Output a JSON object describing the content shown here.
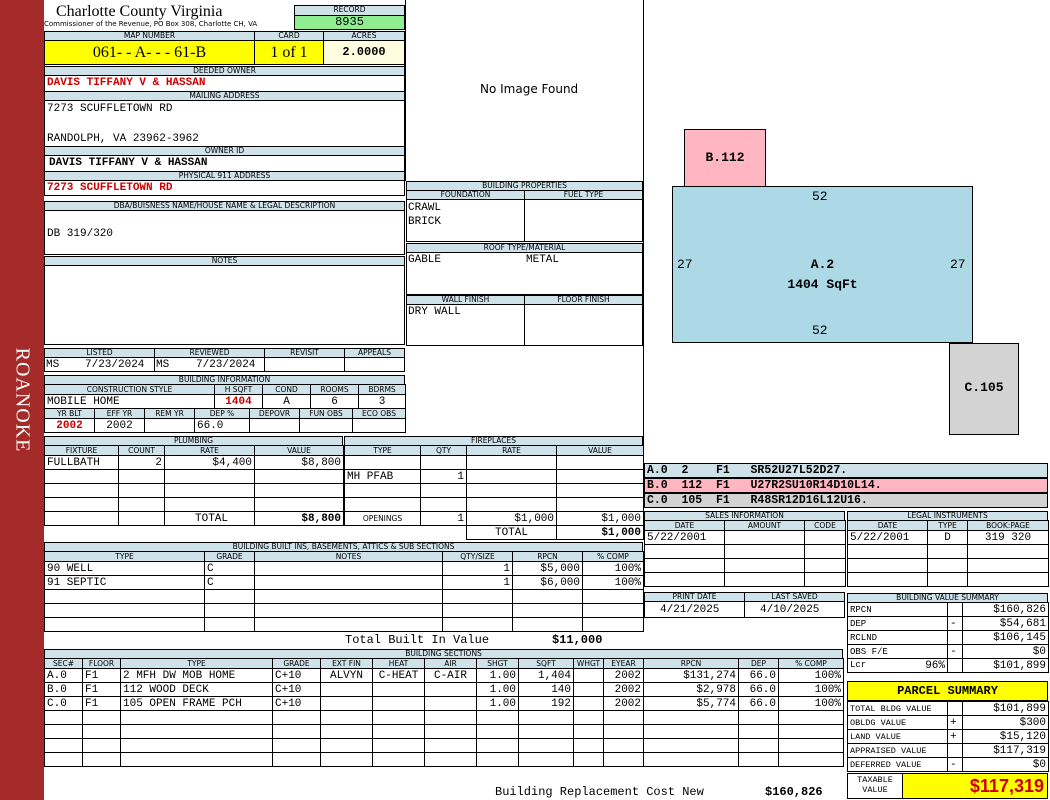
{
  "sidebar": {
    "label": "ROANOKE",
    "color": "#a52a2a"
  },
  "county": {
    "title": "Charlotte County Virginia",
    "subtitle": "Commissioner of the Revenue, PO Box 308, Charlotte CH, VA"
  },
  "record": {
    "label": "RECORD",
    "value": "8935"
  },
  "map": {
    "label": "MAP NUMBER",
    "value": "061- - A- - - 61-B"
  },
  "card": {
    "label": "CARD",
    "value": "1 of 1"
  },
  "acres": {
    "label": "ACRES",
    "value": "2.0000"
  },
  "deeded_owner": {
    "label": "DEEDED OWNER",
    "value": "DAVIS TIFFANY V & HASSAN"
  },
  "mailing": {
    "label": "MAILING ADDRESS",
    "line1": "7273 SCUFFLETOWN RD",
    "line2": "RANDOLPH, VA 23962-3962"
  },
  "owner_id": {
    "label": "OWNER ID",
    "value": "DAVIS TIFFANY V & HASSAN"
  },
  "physical": {
    "label": "PHYSICAL 911 ADDRESS",
    "value": "7273 SCUFFLETOWN RD"
  },
  "dba": {
    "label": "DBA/BUISNESS NAME/HOUSE NAME & LEGAL DESCRIPTION",
    "value": "DB 319/320"
  },
  "notes": {
    "label": "NOTES"
  },
  "listing": {
    "listed_label": "LISTED",
    "reviewed_label": "REVIEWED",
    "revisit_label": "REVISIT",
    "appeals_label": "APPEALS",
    "listed_by": "MS",
    "listed_date": "7/23/2024",
    "reviewed_by": "MS",
    "reviewed_date": "7/23/2024"
  },
  "building_info": {
    "label": "BUILDING INFORMATION",
    "construction_label": "CONSTRUCTION STYLE",
    "hsqft_label": "H SQFT",
    "cond_label": "COND",
    "rooms_label": "ROOMS",
    "bdrms_label": "BDRMS",
    "construction": "MOBILE HOME",
    "hsqft": "1404",
    "cond": "A",
    "rooms": "6",
    "bdrms": "3",
    "yrblt_label": "YR BLT",
    "effyr_label": "EFF YR",
    "remyr_label": "REM YR",
    "dep_label": "DEP %",
    "depovr_label": "DEPOVR",
    "funobs_label": "FUN OBS",
    "ecoobs_label": "ECO OBS",
    "yrblt": "2002",
    "effyr": "2002",
    "dep": "66.0"
  },
  "no_image": "No Image Found",
  "building_props": {
    "label": "BUILDING PROPERTIES",
    "foundation_label": "FOUNDATION",
    "fuel_label": "FUEL TYPE",
    "foundation1": "CRAWL",
    "foundation2": "BRICK",
    "roof_label": "ROOF TYPE/MATERIAL",
    "roof_type": "GABLE",
    "roof_material": "METAL",
    "wall_label": "WALL FINISH",
    "floor_label": "FLOOR FINISH",
    "wall": "DRY WALL"
  },
  "sketch": {
    "b_label": "B.112",
    "a_label": "A.2",
    "a_sqft": "1404 SqFt",
    "c_label": "C.105",
    "top": "52",
    "bottom": "52",
    "left": "27",
    "right": "27",
    "colors": {
      "a": "#add8e6",
      "b": "#ffb6c1",
      "c": "#d3d3d3"
    }
  },
  "sketch_codes": [
    {
      "text": "A.0  2    F1   SR52U27L52D27.",
      "color": "#cfe2ea"
    },
    {
      "text": "B.0  112  F1   U27R2SU10R14D10L14.",
      "color": "#ffb6c1"
    },
    {
      "text": "C.0  105  F1   R48SR12D16L12U16.",
      "color": "#d3d3d3"
    }
  ],
  "plumbing": {
    "label": "PLUMBING",
    "headers": [
      "FIXTURE",
      "COUNT",
      "RATE",
      "VALUE"
    ],
    "rows": [
      [
        "FULLBATH",
        "2",
        "$4,400",
        "$8,800"
      ]
    ],
    "total_label": "TOTAL",
    "total": "$8,800"
  },
  "fireplaces": {
    "label": "FIREPLACES",
    "headers": [
      "TYPE",
      "QTY",
      "RATE",
      "VALUE"
    ],
    "rows": [
      [
        "MH PFAB",
        "1",
        "",
        ""
      ]
    ],
    "openings_label": "OPENINGS",
    "openings_qty": "1",
    "openings_rate": "$1,000",
    "openings_value": "$1,000",
    "total_label": "TOTAL",
    "total": "$1,000"
  },
  "sales": {
    "label": "SALES INFORMATION",
    "headers": [
      "DATE",
      "AMOUNT",
      "CODE"
    ],
    "rows": [
      [
        "5/22/2001",
        "",
        ""
      ]
    ]
  },
  "legal": {
    "label": "LEGAL INSTRUMENTS",
    "headers": [
      "DATE",
      "TYPE",
      "BOOK:PAGE"
    ],
    "rows": [
      [
        "5/22/2001",
        "D",
        "319 320"
      ]
    ]
  },
  "dates": {
    "print_label": "PRINT DATE",
    "saved_label": "LAST SAVED",
    "print": "4/21/2025",
    "saved": "4/10/2025"
  },
  "builtins": {
    "label": "BUILDING BUILT INS, BASEMENTS, ATTICS & SUB SECTIONS",
    "headers": [
      "TYPE",
      "GRADE",
      "NOTES",
      "QTY/SIZE",
      "RPCN",
      "% COMP"
    ],
    "rows": [
      [
        "90 WELL",
        "C",
        "",
        "1",
        "$5,000",
        "100%"
      ],
      [
        "91 SEPTIC",
        "C",
        "",
        "1",
        "$6,000",
        "100%"
      ]
    ],
    "total_label": "Total Built In Value",
    "total": "$11,000"
  },
  "value_summary": {
    "label": "BUILDING VALUE SUMMARY",
    "rows": [
      {
        "label": "RPCN",
        "sign": "",
        "value": "$160,826"
      },
      {
        "label": "DEP",
        "sign": "-",
        "value": "$54,681"
      },
      {
        "label": "RCLND",
        "sign": "",
        "value": "$106,145"
      },
      {
        "label": "OBS F/E",
        "sign": "-",
        "value": "$0"
      },
      {
        "label": "Lcr",
        "pct": "96%",
        "sign": "",
        "value": "$101,899"
      }
    ]
  },
  "sections": {
    "label": "BUILDING SECTIONS",
    "headers": [
      "SEC#",
      "FLOOR",
      "TYPE",
      "GRADE",
      "EXT FIN",
      "HEAT",
      "AIR",
      "SHGT",
      "SQFT",
      "WHGT",
      "EYEAR",
      "RPCN",
      "DEP",
      "% COMP"
    ],
    "rows": [
      [
        "A.0",
        "F1",
        "2 MFH DW MOB HOME",
        "C+10",
        "ALVYN",
        "C-HEAT",
        "C-AIR",
        "1.00",
        "1,404",
        "",
        "2002",
        "$131,274",
        "66.0",
        "100%"
      ],
      [
        "B.0",
        "F1",
        "112 WOOD DECK",
        "C+10",
        "",
        "",
        "",
        "1.00",
        "140",
        "",
        "2002",
        "$2,978",
        "66.0",
        "100%"
      ],
      [
        "C.0",
        "F1",
        "105 OPEN FRAME PCH",
        "C+10",
        "",
        "",
        "",
        "1.00",
        "192",
        "",
        "2002",
        "$5,774",
        "66.0",
        "100%"
      ]
    ],
    "footer_label": "Building Replacement Cost New",
    "footer_value": "$160,826"
  },
  "parcel": {
    "label": "PARCEL SUMMARY",
    "rows": [
      {
        "label": "TOTAL BLDG VALUE",
        "sign": "",
        "value": "$101,899"
      },
      {
        "label": "OBLDG VALUE",
        "sign": "+",
        "value": "$300"
      },
      {
        "label": "LAND VALUE",
        "sign": "+",
        "value": "$15,120"
      },
      {
        "label": "APPRAISED VALUE",
        "sign": "",
        "value": "$117,319"
      },
      {
        "label": "DEFERRED VALUE",
        "sign": "-",
        "value": "$0"
      }
    ],
    "taxable_label": "TAXABLE VALUE",
    "taxable": "$117,319"
  }
}
